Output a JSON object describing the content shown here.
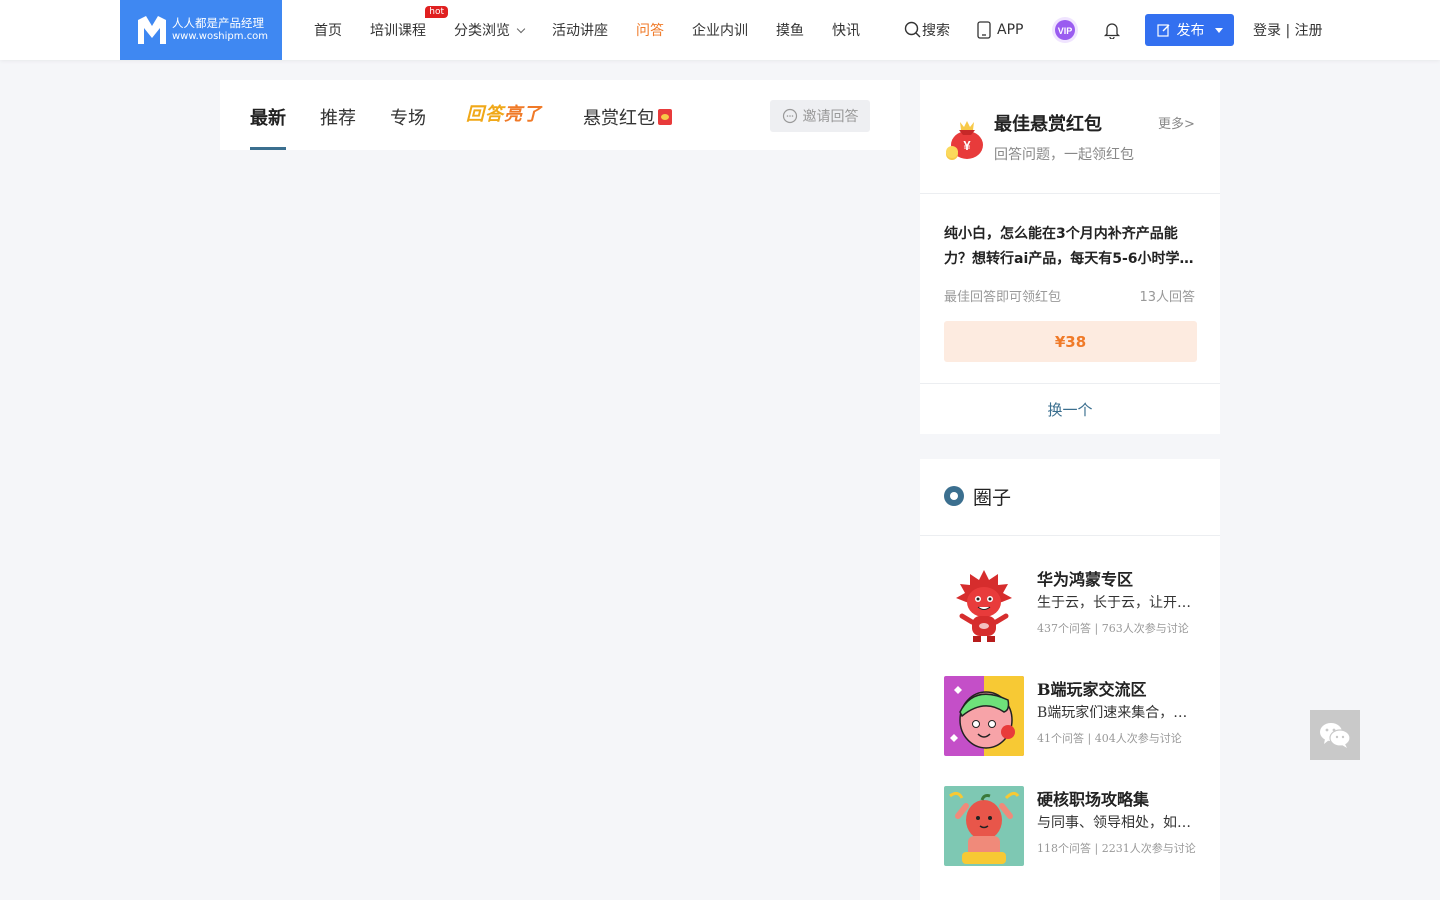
{
  "header": {
    "logo": {
      "line1": "人人都是产品经理",
      "line2": "www.woshipm.com",
      "bg": "#3f88f2"
    },
    "nav": [
      {
        "label": "首页"
      },
      {
        "label": "培训课程",
        "badge": "hot"
      },
      {
        "label": "分类浏览",
        "dropdown": true
      },
      {
        "label": "活动讲座"
      },
      {
        "label": "问答",
        "active": true
      },
      {
        "label": "企业内训"
      },
      {
        "label": "摸鱼"
      },
      {
        "label": "快讯"
      }
    ],
    "search_label": "搜索",
    "app_label": "APP",
    "vip_label": "VIP",
    "publish_label": "发布",
    "login_label": "登录 | 注册",
    "accent": "#3370f0",
    "active_color": "#f07a28"
  },
  "tabs": {
    "items": [
      "最新",
      "推荐",
      "专场"
    ],
    "highlight": "回答",
    "highlight_bang": "亮了",
    "redpack": "悬赏红包",
    "invite_label": "邀请回答"
  },
  "bounty": {
    "title": "最佳悬赏红包",
    "subtitle": "回答问题，一起领红包",
    "more": "更多>",
    "question": "纯小白，怎么能在3个月内补齐产品能力？想转行ai产品，每天有5-6小时学…",
    "hint": "最佳回答即可领红包",
    "answers": "13人回答",
    "reward": "¥38",
    "switch_label": "换一个"
  },
  "circles": {
    "title": "圈子",
    "items": [
      {
        "name": "华为鸿蒙专区",
        "desc": "生于云，长于云，让开…",
        "stats": "437个问答 | 763人次参与讨论"
      },
      {
        "name": "B端玩家交流区",
        "desc": "B端玩家们速来集合，…",
        "stats": "41个问答 | 404人次参与讨论"
      },
      {
        "name": "硬核职场攻略集",
        "desc": "与同事、领导相处，如…",
        "stats": "118个问答 | 2231人次参与讨论"
      }
    ]
  }
}
